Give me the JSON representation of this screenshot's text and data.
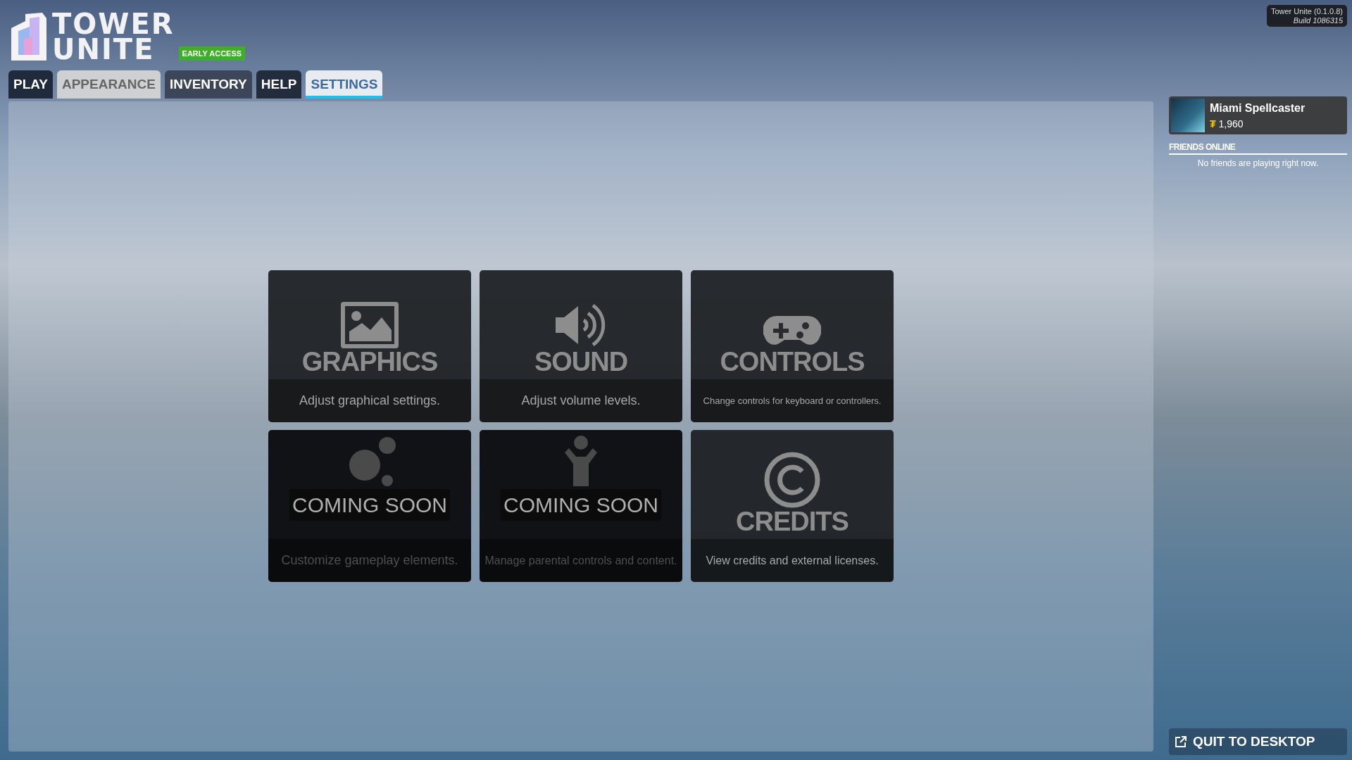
{
  "logo": {
    "line1": "TOWER",
    "line2": "UNITE",
    "badge": "EARLY ACCESS"
  },
  "tabs": [
    {
      "label": "PLAY",
      "selected": false,
      "color": "#1f2a3c"
    },
    {
      "label": "APPEARANCE",
      "selected": false,
      "color": "#cfd0d3"
    },
    {
      "label": "INVENTORY",
      "selected": false,
      "color": "#3d4658"
    },
    {
      "label": "HELP",
      "selected": false,
      "color": "#222c3d"
    },
    {
      "label": "SETTINGS",
      "selected": true,
      "color": "#e8ecf0"
    }
  ],
  "version": {
    "line1": "Tower Unite (0.1.0.8)",
    "line2": "Build 1086315"
  },
  "tiles": [
    {
      "title": "GRAPHICS",
      "description": "Adjust graphical settings.",
      "disabled": false
    },
    {
      "title": "SOUND",
      "description": "Adjust volume levels.",
      "disabled": false
    },
    {
      "title": "CONTROLS",
      "description": "Change controls for keyboard or controllers.",
      "disabled": false
    },
    {
      "description": "Customize gameplay elements.",
      "disabled": true,
      "badge": "COMING SOON"
    },
    {
      "description": "Manage parental controls and content.",
      "disabled": true,
      "badge": "COMING SOON"
    },
    {
      "title": "CREDITS",
      "description": "View credits and external licenses.",
      "disabled": false
    }
  ],
  "profile": {
    "name": "Miami Spellcaster",
    "currency_symbol": "₮",
    "balance": "1,960"
  },
  "friends": {
    "heading": "FRIENDS ONLINE",
    "empty_message": "No friends are playing right now."
  },
  "quit_button": "QUIT TO DESKTOP"
}
